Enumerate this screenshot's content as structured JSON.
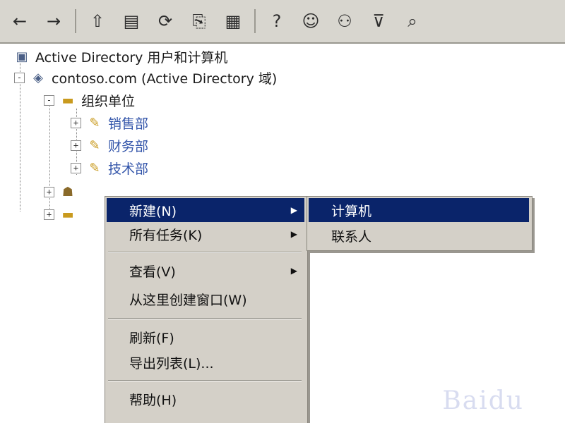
{
  "toolbar": {
    "buttons": [
      {
        "icon": "back-arrow-icon",
        "glyph": "←"
      },
      {
        "icon": "forward-arrow-icon",
        "glyph": "→"
      },
      {
        "icon": "up-folder-icon",
        "glyph": "⇧"
      },
      {
        "icon": "console-tree-icon",
        "glyph": "▤"
      },
      {
        "icon": "refresh-icon",
        "glyph": "⟳"
      },
      {
        "icon": "export-list-icon",
        "glyph": "⎘"
      },
      {
        "icon": "properties-icon",
        "glyph": "▦"
      },
      {
        "icon": "help-icon",
        "glyph": "?"
      },
      {
        "icon": "add-user-icon",
        "glyph": "☺"
      },
      {
        "icon": "add-group-icon",
        "glyph": "⚇"
      },
      {
        "icon": "filter-icon",
        "glyph": "⊽"
      },
      {
        "icon": "find-icon",
        "glyph": "⌕"
      }
    ]
  },
  "tree": {
    "nodes": [
      {
        "label": "Active Directory 用户和计算机",
        "icon": "computer-icon",
        "glyph": "▣",
        "expander": "",
        "link": false
      },
      {
        "label": "contoso.com (Active Directory 域)",
        "icon": "domain-icon",
        "glyph": "◈",
        "expander": "-",
        "link": false
      },
      {
        "label": "组织单位",
        "icon": "folder-icon",
        "glyph": "▬",
        "expander": "-",
        "link": false
      },
      {
        "label": "销售部",
        "icon": "ou-icon",
        "glyph": "✎",
        "expander": "+",
        "link": true
      },
      {
        "label": "财务部",
        "icon": "ou-icon",
        "glyph": "✎",
        "expander": "+",
        "link": true
      },
      {
        "label": "技术部",
        "icon": "ou-icon",
        "glyph": "✎",
        "expander": "+",
        "link": true
      },
      {
        "label": "",
        "icon": "user-folder-icon",
        "glyph": "☗",
        "expander": "+",
        "link": false
      },
      {
        "label": "",
        "icon": "folder-icon",
        "glyph": "▬",
        "expander": "+",
        "link": false
      }
    ]
  },
  "menu": {
    "items": [
      {
        "label": "新建(N)",
        "highlight": true,
        "arrow": true
      },
      {
        "label": "所有任务(K)",
        "highlight": false,
        "arrow": true
      },
      {
        "label": "",
        "separator": true
      },
      {
        "label": "查看(V)",
        "highlight": false,
        "arrow": true
      },
      {
        "label": "从这里创建窗口(W)",
        "highlight": false,
        "arrow": false
      },
      {
        "label": "",
        "separator": true
      },
      {
        "label": "刷新(F)",
        "highlight": false,
        "arrow": false
      },
      {
        "label": "导出列表(L)...",
        "highlight": false,
        "arrow": false
      },
      {
        "label": "",
        "separator": true
      },
      {
        "label": "帮助(H)",
        "highlight": false,
        "arrow": false
      }
    ]
  },
  "submenu": {
    "items": [
      {
        "label": "计算机",
        "highlight": true
      },
      {
        "label": "联系人",
        "highlight": false
      }
    ]
  },
  "watermark": "Baidu",
  "colors": {
    "highlight": "#0a246a",
    "menu_bg": "#d4d0c8",
    "toolbar_bg": "#d8d6cf"
  }
}
